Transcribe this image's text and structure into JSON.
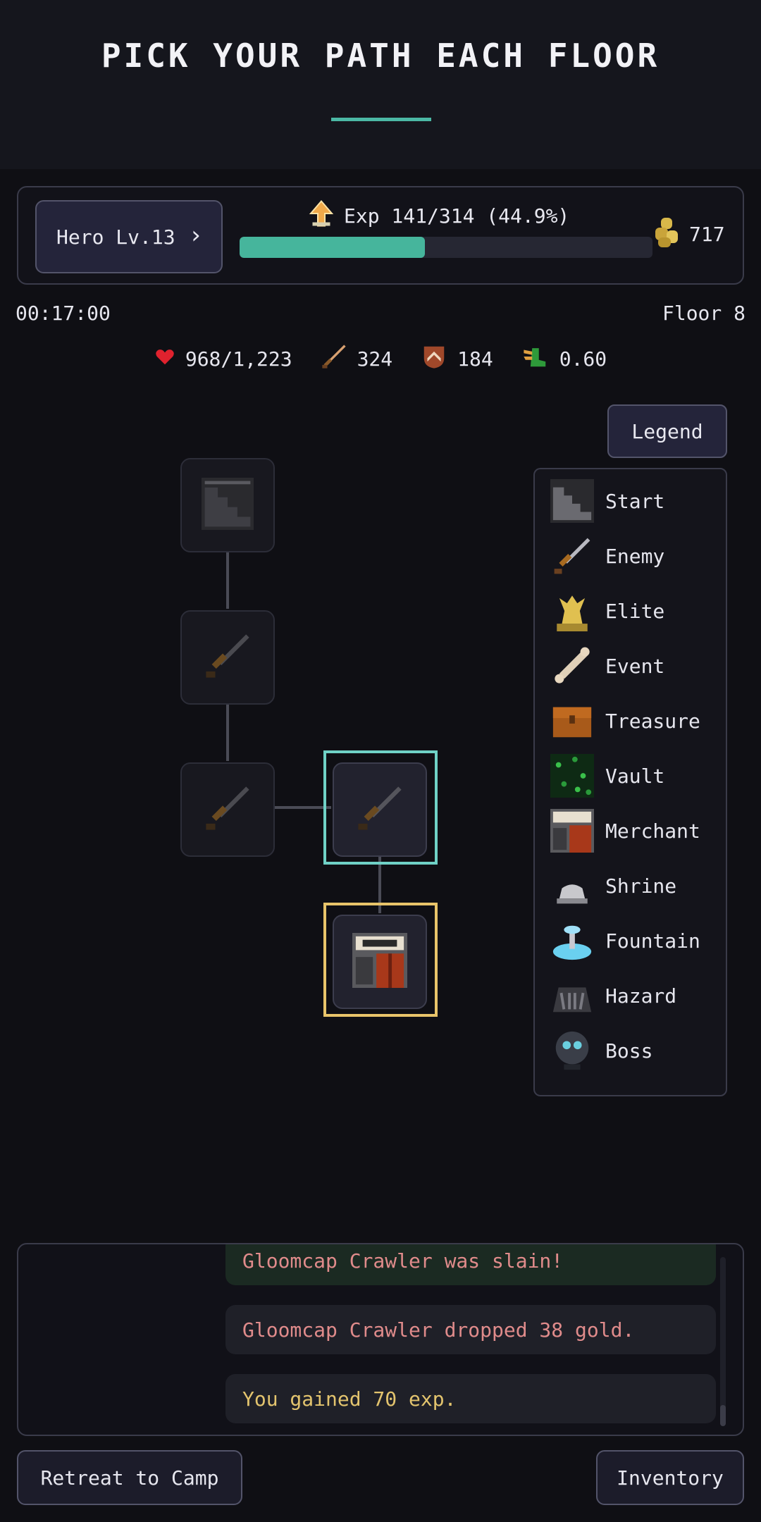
{
  "header": {
    "title": "PICK YOUR PATH EACH FLOOR"
  },
  "hud": {
    "hero_label": "Hero Lv.13",
    "exp_text": "Exp 141/314 (44.9%)",
    "exp_fraction": 0.449,
    "gold": "717",
    "exp_color": "#46b59c"
  },
  "status": {
    "timer": "00:17:00",
    "floor": "Floor 8"
  },
  "stats": {
    "hp": "968/1,223",
    "attack": "324",
    "defense": "184",
    "speed": "0.60"
  },
  "legend": {
    "button_label": "Legend",
    "items": [
      {
        "label": "Start",
        "icon": "stairs-icon"
      },
      {
        "label": "Enemy",
        "icon": "sword-icon"
      },
      {
        "label": "Elite",
        "icon": "golden-statue-icon"
      },
      {
        "label": "Event",
        "icon": "bone-icon"
      },
      {
        "label": "Treasure",
        "icon": "chest-icon"
      },
      {
        "label": "Vault",
        "icon": "vault-icon"
      },
      {
        "label": "Merchant",
        "icon": "shop-icon"
      },
      {
        "label": "Shrine",
        "icon": "shrine-icon"
      },
      {
        "label": "Fountain",
        "icon": "fountain-icon"
      },
      {
        "label": "Hazard",
        "icon": "trap-icon"
      },
      {
        "label": "Boss",
        "icon": "boss-icon"
      }
    ]
  },
  "map": {
    "nodes": [
      {
        "type": "Start",
        "state": "visited"
      },
      {
        "type": "Enemy",
        "state": "visited"
      },
      {
        "type": "Enemy",
        "state": "visited"
      },
      {
        "type": "Enemy",
        "state": "selected"
      },
      {
        "type": "Merchant",
        "state": "current"
      }
    ]
  },
  "log": {
    "messages": [
      {
        "text": "Gloomcap Crawler was slain!",
        "color": "#e08b8b"
      },
      {
        "text": "Gloomcap Crawler dropped 38 gold.",
        "color": "#e08b8b"
      },
      {
        "text": "You gained 70 exp.",
        "color": "#e3c46e"
      }
    ]
  },
  "actions": {
    "retreat": "Retreat to Camp",
    "inventory": "Inventory"
  }
}
